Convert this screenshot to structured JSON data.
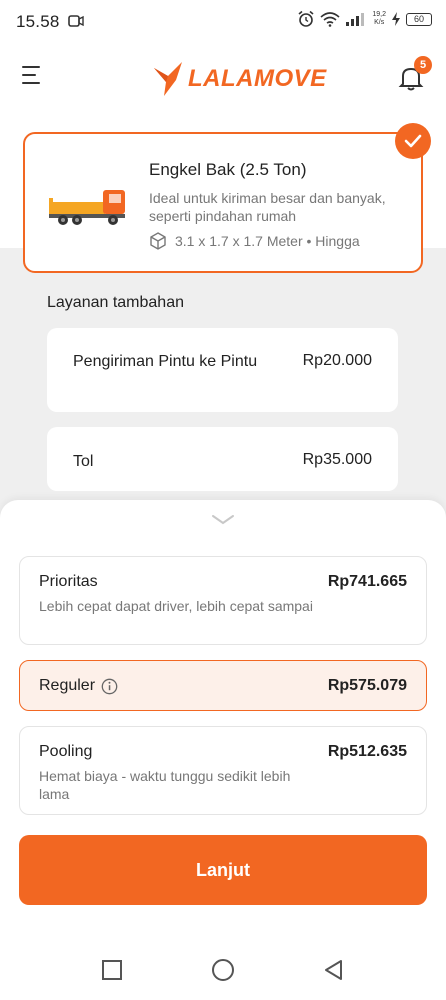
{
  "status_bar": {
    "time": "15.58",
    "network_speed_value": "19,2",
    "network_speed_unit": "K/s",
    "battery": "60"
  },
  "header": {
    "logo_text": "LALAMOVE",
    "notification_count": "5",
    "brand_color": "#f26722"
  },
  "vehicle": {
    "name": "Engkel Bak (2.5 Ton)",
    "description": "Ideal untuk kiriman besar dan banyak, seperti pindahan rumah",
    "dimensions": "3.1 x 1.7 x 1.7 Meter • Hingga",
    "selected": true
  },
  "additional_services": {
    "title": "Layanan tambahan",
    "items": [
      {
        "name": "Pengiriman Pintu ke Pintu",
        "price": "Rp20.000"
      },
      {
        "name": "Tol",
        "price": "Rp35.000"
      }
    ]
  },
  "delivery_options": [
    {
      "name": "Prioritas",
      "price": "Rp741.665",
      "description": "Lebih cepat dapat driver, lebih cepat sampai",
      "selected": false
    },
    {
      "name": "Reguler",
      "price": "Rp575.079",
      "description": "",
      "selected": true
    },
    {
      "name": "Pooling",
      "price": "Rp512.635",
      "description": "Hemat biaya - waktu tunggu sedikit lebih lama",
      "selected": false
    }
  ],
  "continue_button": {
    "label": "Lanjut"
  },
  "icons": {
    "menu": "menu-icon",
    "bell": "bell-icon",
    "check": "check-icon",
    "truck": "truck-icon",
    "box": "box-icon",
    "info": "info-icon",
    "chevron": "chevron-down-icon",
    "nav_recent": "square-icon",
    "nav_home": "circle-icon",
    "nav_back": "triangle-back-icon"
  }
}
